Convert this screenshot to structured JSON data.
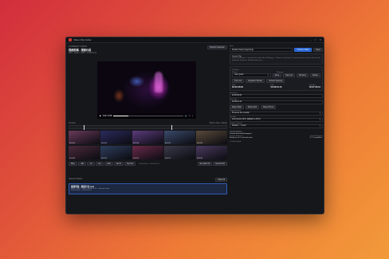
{
  "window": {
    "title": "Video Clip Cutter",
    "controls": [
      "–",
      "□",
      "✕"
    ]
  },
  "left": {
    "section_label": "CURRENT VIDEO",
    "file_name": "视频剪辑 - 视频片段",
    "file_meta": "MP4 · 1920 × 1080 · 00:08:24.13",
    "refresh_label": "Refresh Selection",
    "player": {
      "time": "0:02 / 0:08",
      "progress": 0.22
    },
    "timeline": {
      "label": "Timeline",
      "zoom_label": "Whole video / Range",
      "pins": [
        0.09,
        0.65
      ],
      "thumbnails": [
        {
          "caption": "00:00:00",
          "color": "#6a3a5a"
        },
        {
          "caption": "00:00:54",
          "color": "#2a2a5e"
        },
        {
          "caption": "00:01:48",
          "color": "#5c3b7c"
        },
        {
          "caption": "00:02:42",
          "color": "#3a4a6a"
        },
        {
          "caption": "00:03:36",
          "color": "#5a4a3a"
        },
        {
          "caption": "00:04:30",
          "color": "#4a2a3a"
        },
        {
          "caption": "00:05:24",
          "color": "#2e3e5e"
        },
        {
          "caption": "00:06:18",
          "color": "#6a2a4a"
        },
        {
          "caption": "00:07:12",
          "color": "#3a3a4a"
        },
        {
          "caption": "00:08:06",
          "color": "#4a3a5e"
        }
      ],
      "buttons": [
        "Play",
        "-10s",
        "-1s",
        "+1s",
        "+10s",
        "Set In",
        "Set Out"
      ],
      "info": "00:00:00.00 – 00:08:24.13",
      "right_buttons": [
        "Set Start 00",
        "Set End 00"
      ]
    },
    "selected": {
      "label": "Selected Videos",
      "clear_label": "Clear All",
      "item": {
        "name": "视频剪辑 - 视频片段.mp4",
        "detail1": "MP4 · 1920 × 1080 · 00:08:24.13 · selected entire",
        "detail2": "00:00:00.00 – 00:08:24.13"
      }
    }
  },
  "right": {
    "section_label": "Save",
    "output_field": "Default Output (beginning)",
    "choose_label": "Choose Folder",
    "open_label": "Open",
    "current_clip_label": "Current Clip",
    "current_clip_desc": "Selected duration. 1 seconds for a this file or FFmpeg... Choose a start time. In and out points can also be set with keyboard shortcuts. Nearby frames are...",
    "setting_label": "▾ Setting",
    "preset_label": "Preset",
    "manage_label": "Manage",
    "preset_value": "User Quick",
    "preset_buttons": [
      "Save",
      "Save As",
      "Rename",
      "Delete"
    ],
    "mode_buttons": [
      "Trim Cut",
      "Separate Stream",
      "Include Spacing"
    ],
    "stats": [
      {
        "k": "Start",
        "v": "00:00:48.00"
      },
      {
        "k": "End",
        "v": "00:08:24.13"
      },
      {
        "k": "Duration",
        "v": "00:07:36.13"
      }
    ],
    "start_field_label": "Start Time",
    "start_value": "00:00:48.00",
    "end_field_label": "End Time",
    "end_value": "00:08:24.13",
    "time_buttons": [
      "Reset Start",
      "Reset End",
      "Reset Times"
    ],
    "format_label": "Output Format",
    "format_value": "Preserve the encoder",
    "encoder_label": "Encoder",
    "encoder_value": "Auto (prefer GPU, fallback to CPU)",
    "quality_label": "Quality / Options",
    "quality_value": "Default + ↑ tuned",
    "progress_section": "PROGRESS",
    "progress_title": "Current and overall progress",
    "current_progress_label": "Current Progress",
    "overall_progress_label": "Overall Progress",
    "current_progress_value": "Ready to cut 1 selected video",
    "overall_progress_value": "0 / 1 completed",
    "detail_label": "▸ Detail Details"
  },
  "colors": {
    "accent": "#1f5fd1",
    "bg": "#16171b"
  }
}
